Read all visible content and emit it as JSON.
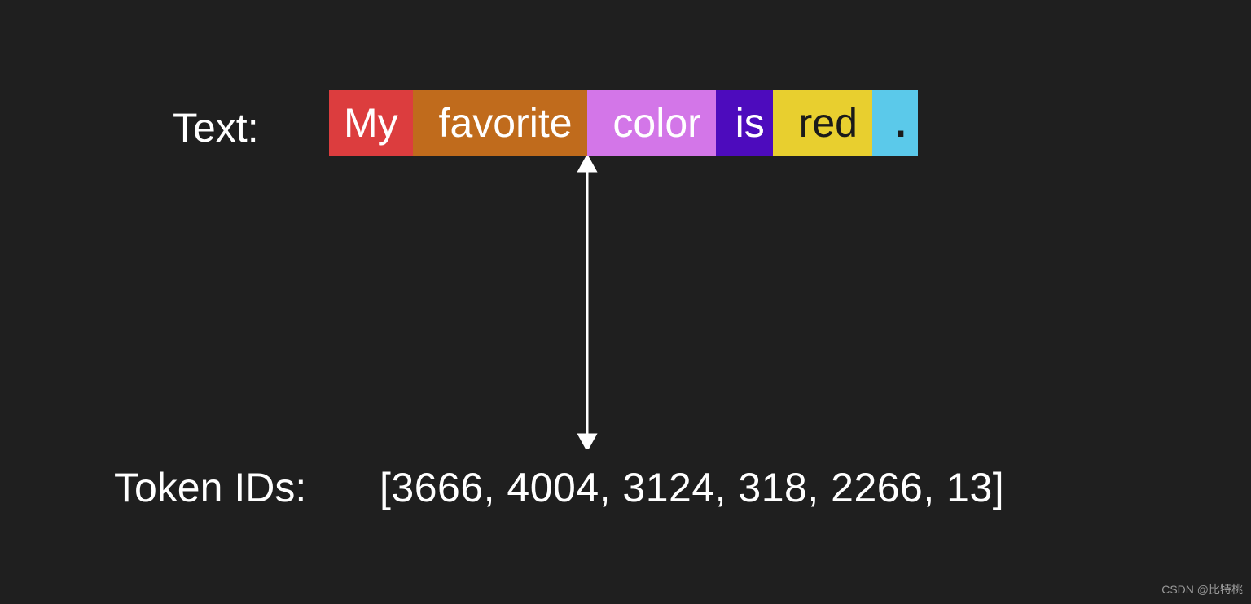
{
  "labels": {
    "text": "Text:",
    "tokenids": "Token IDs:"
  },
  "tokens": [
    {
      "text": "My",
      "color_bg": "#dc3d3e",
      "color_fg": "#ffffff"
    },
    {
      "text": " favorite",
      "color_bg": "#c06b1c",
      "color_fg": "#ffffff"
    },
    {
      "text": " color",
      "color_bg": "#d376e8",
      "color_fg": "#ffffff"
    },
    {
      "text": " is",
      "color_bg": "#4d0bbd",
      "color_fg": "#ffffff"
    },
    {
      "text": " red",
      "color_bg": "#e8cf2f",
      "color_fg": "#1a1a1a"
    },
    {
      "text": " .",
      "color_bg": "#5bc9ea",
      "color_fg": "#1a1a1a"
    }
  ],
  "token_ids": [
    3666,
    4004,
    3124,
    318,
    2266,
    13
  ],
  "token_ids_display": "[3666, 4004, 3124, 318, 2266, 13]",
  "watermark": "CSDN @比特桃"
}
